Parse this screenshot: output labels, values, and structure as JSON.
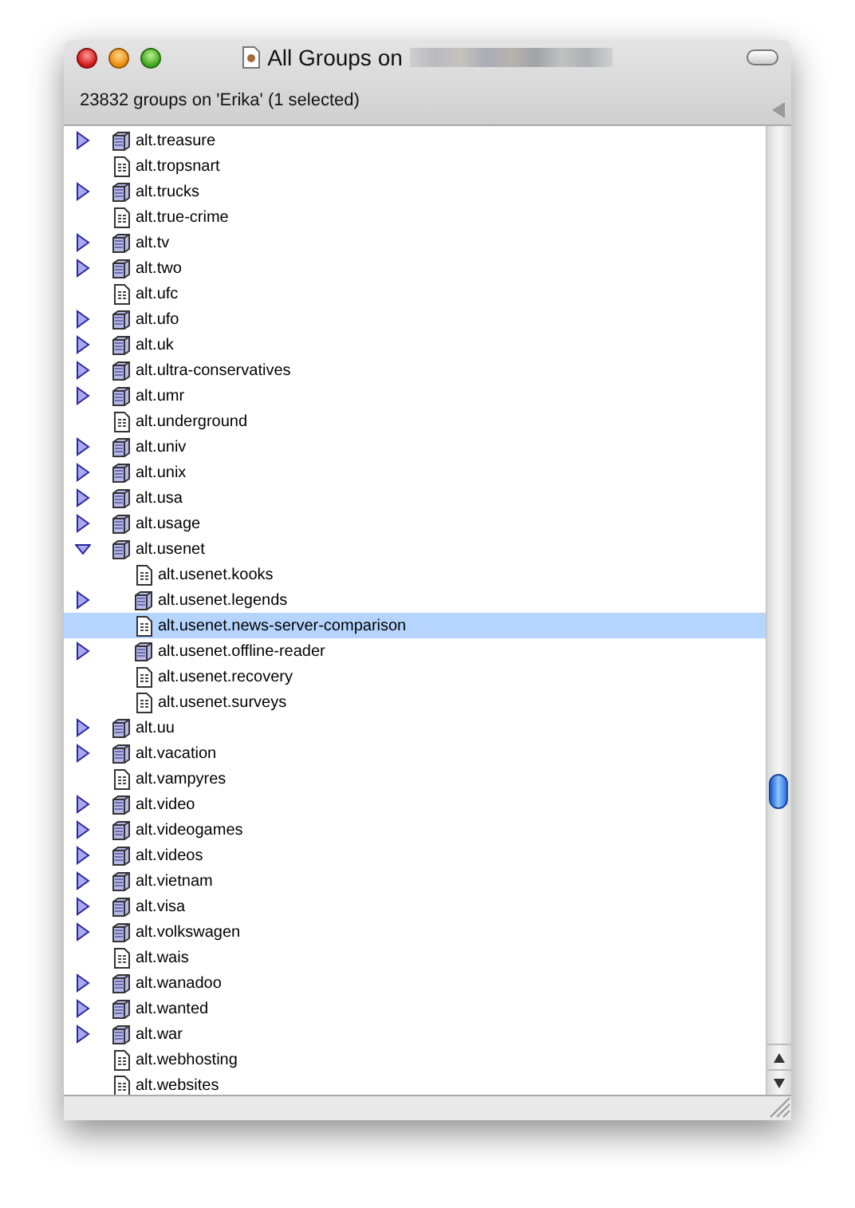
{
  "window": {
    "title": "All Groups on",
    "header": "23832 groups on 'Erika' (1 selected)"
  },
  "items": [
    {
      "name": "alt.treasure",
      "kind": "group",
      "expanded": false,
      "selected": false
    },
    {
      "name": "alt.tropsnart",
      "kind": "leaf",
      "selected": false
    },
    {
      "name": "alt.trucks",
      "kind": "group",
      "expanded": false,
      "selected": false
    },
    {
      "name": "alt.true-crime",
      "kind": "leaf",
      "selected": false
    },
    {
      "name": "alt.tv",
      "kind": "group",
      "expanded": false,
      "selected": false
    },
    {
      "name": "alt.two",
      "kind": "group",
      "expanded": false,
      "selected": false
    },
    {
      "name": "alt.ufc",
      "kind": "leaf",
      "selected": false
    },
    {
      "name": "alt.ufo",
      "kind": "group",
      "expanded": false,
      "selected": false
    },
    {
      "name": "alt.uk",
      "kind": "group",
      "expanded": false,
      "selected": false
    },
    {
      "name": "alt.ultra-conservatives",
      "kind": "group",
      "expanded": false,
      "selected": false
    },
    {
      "name": "alt.umr",
      "kind": "group",
      "expanded": false,
      "selected": false
    },
    {
      "name": "alt.underground",
      "kind": "leaf",
      "selected": false
    },
    {
      "name": "alt.univ",
      "kind": "group",
      "expanded": false,
      "selected": false
    },
    {
      "name": "alt.unix",
      "kind": "group",
      "expanded": false,
      "selected": false
    },
    {
      "name": "alt.usa",
      "kind": "group",
      "expanded": false,
      "selected": false
    },
    {
      "name": "alt.usage",
      "kind": "group",
      "expanded": false,
      "selected": false
    },
    {
      "name": "alt.usenet",
      "kind": "group",
      "expanded": true,
      "selected": false,
      "children": [
        {
          "name": "alt.usenet.kooks",
          "kind": "leaf",
          "selected": false
        },
        {
          "name": "alt.usenet.legends",
          "kind": "group",
          "expanded": false,
          "selected": false
        },
        {
          "name": "alt.usenet.news-server-comparison",
          "kind": "leaf",
          "selected": true
        },
        {
          "name": "alt.usenet.offline-reader",
          "kind": "group",
          "expanded": false,
          "selected": false
        },
        {
          "name": "alt.usenet.recovery",
          "kind": "leaf",
          "selected": false
        },
        {
          "name": "alt.usenet.surveys",
          "kind": "leaf",
          "selected": false
        }
      ]
    },
    {
      "name": "alt.uu",
      "kind": "group",
      "expanded": false,
      "selected": false
    },
    {
      "name": "alt.vacation",
      "kind": "group",
      "expanded": false,
      "selected": false
    },
    {
      "name": "alt.vampyres",
      "kind": "leaf",
      "selected": false
    },
    {
      "name": "alt.video",
      "kind": "group",
      "expanded": false,
      "selected": false
    },
    {
      "name": "alt.videogames",
      "kind": "group",
      "expanded": false,
      "selected": false
    },
    {
      "name": "alt.videos",
      "kind": "group",
      "expanded": false,
      "selected": false
    },
    {
      "name": "alt.vietnam",
      "kind": "group",
      "expanded": false,
      "selected": false
    },
    {
      "name": "alt.visa",
      "kind": "group",
      "expanded": false,
      "selected": false
    },
    {
      "name": "alt.volkswagen",
      "kind": "group",
      "expanded": false,
      "selected": false
    },
    {
      "name": "alt.wais",
      "kind": "leaf",
      "selected": false
    },
    {
      "name": "alt.wanadoo",
      "kind": "group",
      "expanded": false,
      "selected": false
    },
    {
      "name": "alt.wanted",
      "kind": "group",
      "expanded": false,
      "selected": false
    },
    {
      "name": "alt.war",
      "kind": "group",
      "expanded": false,
      "selected": false
    },
    {
      "name": "alt.webhosting",
      "kind": "leaf",
      "selected": false
    },
    {
      "name": "alt.websites",
      "kind": "leaf",
      "selected": false
    }
  ]
}
